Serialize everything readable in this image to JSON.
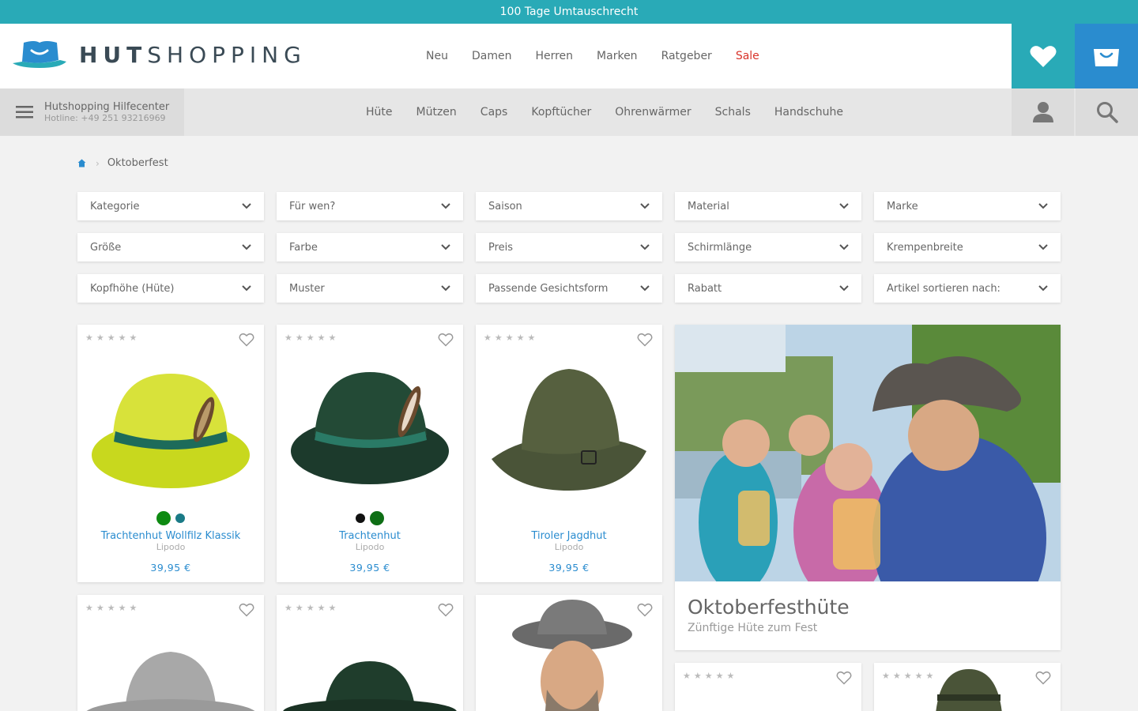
{
  "topbar": {
    "text": "100 Tage Umtauschrecht"
  },
  "header": {
    "logo_bold": "HUT",
    "logo_light": "SHOPPING",
    "nav": [
      {
        "label": "Neu"
      },
      {
        "label": "Damen"
      },
      {
        "label": "Herren"
      },
      {
        "label": "Marken"
      },
      {
        "label": "Ratgeber"
      },
      {
        "label": "Sale"
      }
    ],
    "wishlist_icon": "heart-icon",
    "cart_icon": "bag-icon"
  },
  "subbar": {
    "help_title": "Hutshopping Hilfecenter",
    "help_hotline": "Hotline: +49 251 93216969",
    "categories": [
      {
        "label": "Hüte"
      },
      {
        "label": "Mützen"
      },
      {
        "label": "Caps"
      },
      {
        "label": "Kopftücher"
      },
      {
        "label": "Ohrenwärmer"
      },
      {
        "label": "Schals"
      },
      {
        "label": "Handschuhe"
      }
    ]
  },
  "breadcrumb": {
    "current": "Oktoberfest"
  },
  "filters": [
    "Kategorie",
    "Für wen?",
    "Saison",
    "Material",
    "Marke",
    "Größe",
    "Farbe",
    "Preis",
    "Schirmlänge",
    "Krempenbreite",
    "Kopfhöhe (Hüte)",
    "Muster",
    "Passende Gesichtsform",
    "Rabatt",
    "Artikel sortieren nach:"
  ],
  "products": [
    {
      "name": "Trachtenhut Wollfilz Klassik",
      "brand": "Lipodo",
      "price": "39,95 €",
      "rating": 0,
      "swatches": [
        "#0e8a12",
        "#1a7a86"
      ]
    },
    {
      "name": "Trachtenhut",
      "brand": "Lipodo",
      "price": "39,95 €",
      "rating": 0,
      "swatches": [
        "#111111",
        "#0e6e15"
      ]
    },
    {
      "name": "Tiroler Jagdhut",
      "brand": "Lipodo",
      "price": "39,95 €",
      "rating": 0,
      "swatches": []
    }
  ],
  "promo": {
    "title": "Oktoberfesthüte",
    "subtitle": "Zünftige Hüte zum Fest"
  },
  "colors": {
    "teal": "#29aab7",
    "blue": "#2a8ccf",
    "sale_red": "#d9342b"
  }
}
